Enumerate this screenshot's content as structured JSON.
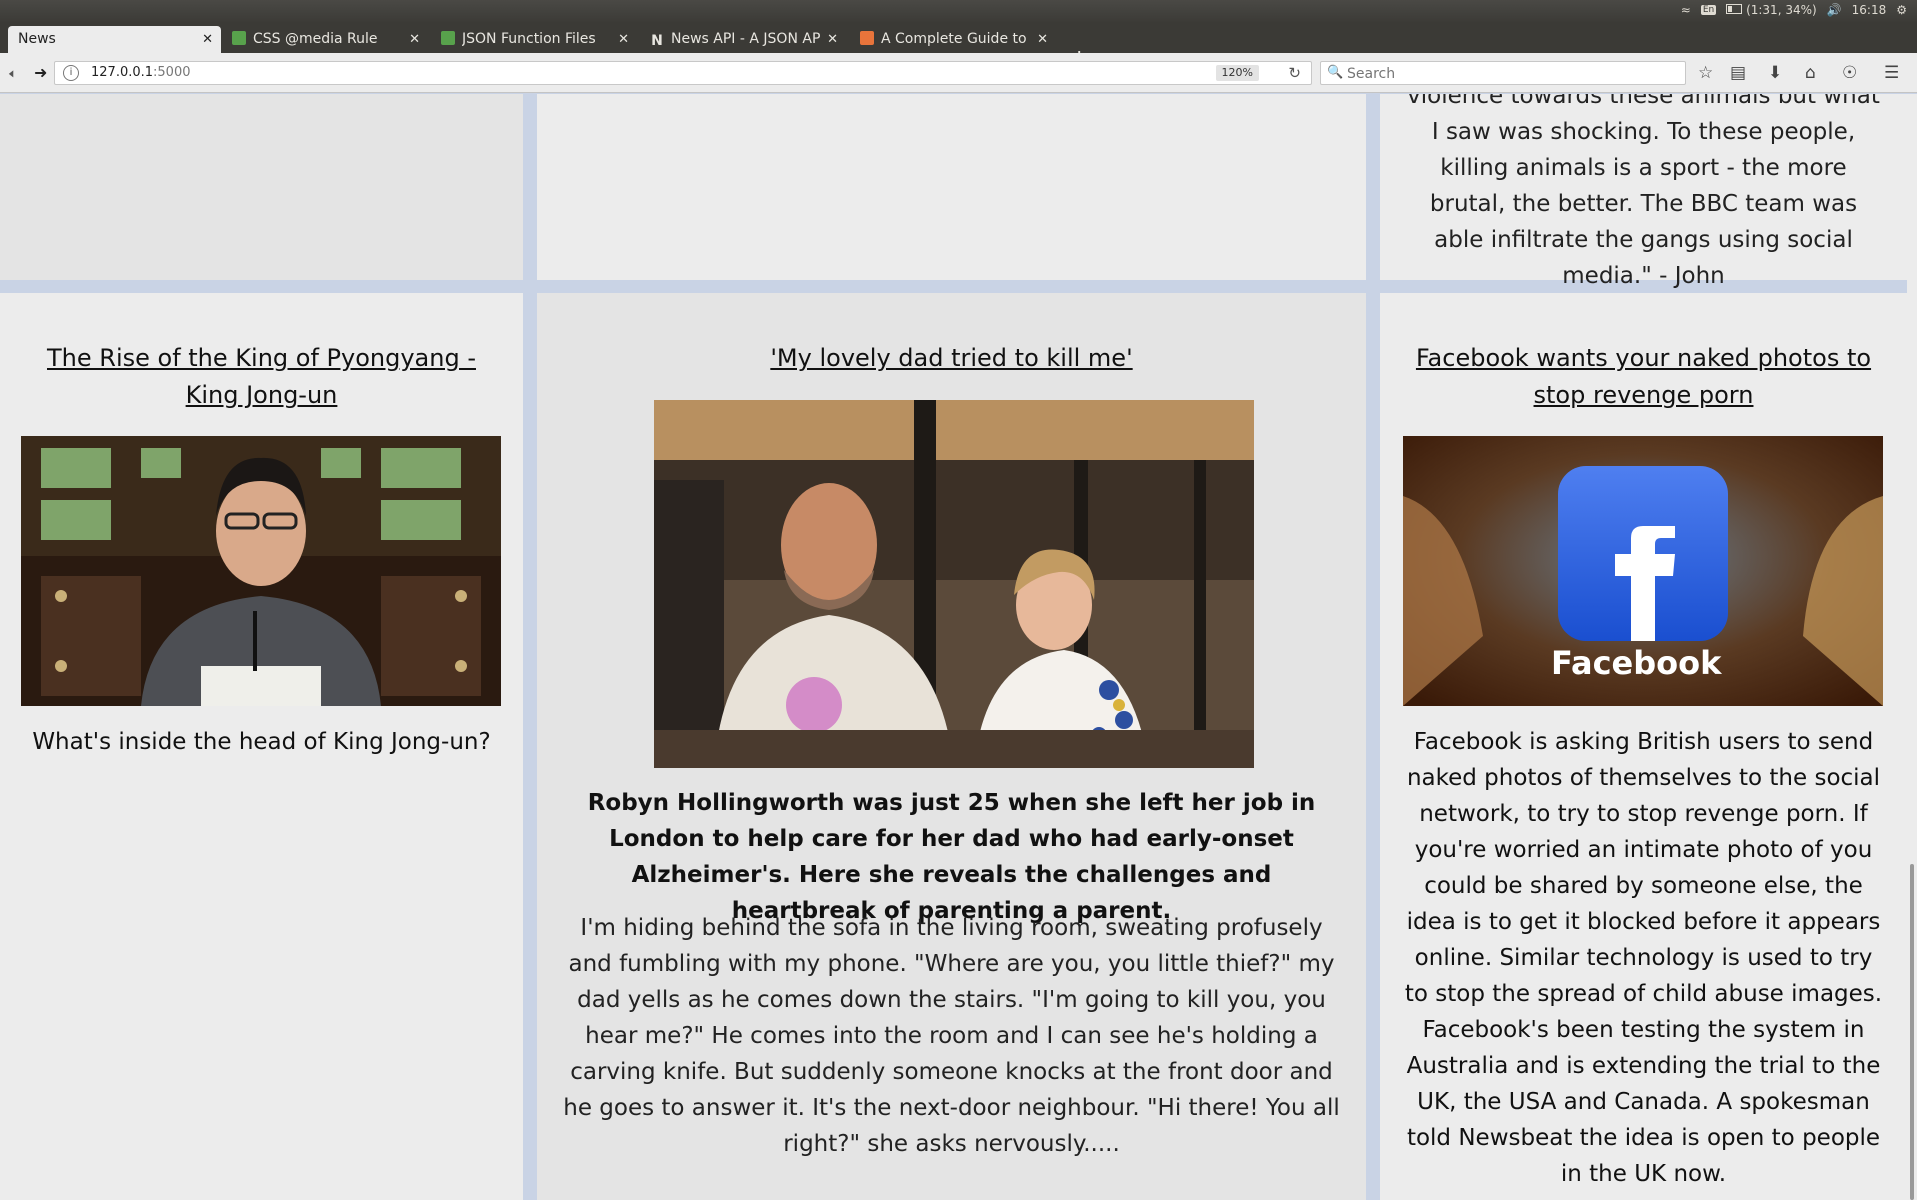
{
  "system": {
    "lang": "En",
    "battery": "(1:31, 34%)",
    "clock": "16:18"
  },
  "tabs": [
    {
      "title": "News",
      "favicon": "none",
      "active": true
    },
    {
      "title": "CSS @media Rule",
      "favicon": "w3schools-icon",
      "active": false
    },
    {
      "title": "JSON Function Files",
      "favicon": "w3schools-icon",
      "active": false
    },
    {
      "title": "News API - A JSON API",
      "favicon": "newsapi-icon",
      "active": false
    },
    {
      "title": "A Complete Guide to G",
      "favicon": "css-tricks-icon",
      "active": false
    }
  ],
  "new_tab": "+",
  "nav": {
    "url_host": "127.0.0.1",
    "url_port": ":5000",
    "zoom": "120%",
    "search_placeholder": "Search"
  },
  "page": {
    "top_snippet": "violence towards these animals but what I saw was shocking. To these people, killing animals is a sport - the more brutal, the better. The BBC team was able infiltrate the gangs using social media.\" - John",
    "articles": [
      {
        "title": "The Rise of the King of Pyongyang - King Jong-un",
        "image": "man-at-desk-photo",
        "summary": "What's inside the head of King Jong-un?"
      },
      {
        "title": "'My lovely dad tried to kill me'",
        "image": "father-and-daughter-photo",
        "summary": "Robyn Hollingworth was just 25 when she left her job in London to help care for her dad who had early-onset Alzheimer's. Here she reveals the challenges and heartbreak of parenting a parent.",
        "body": "I'm hiding behind the sofa in the living room, sweating profusely and fumbling with my phone. \"Where are you, you little thief?\" my dad yells as he comes down the stairs. \"I'm going to kill you, you hear me?\" He comes into the room and I can see he's holding a carving knife. But suddenly someone knocks at the front door and he goes to answer it. It's the next-door neighbour. \"Hi there! You all right?\" she asks nervously....."
      },
      {
        "title": "Facebook wants your naked photos to stop revenge porn",
        "image": "facebook-logo-photo",
        "image_text": "Facebook",
        "summary": "Facebook is asking British users to send naked photos of themselves to the social network, to try to stop revenge porn. If you're worried an intimate photo of you could be shared by someone else, the idea is to get it blocked before it appears online. Similar technology is used to try to stop the spread of child abuse images. Facebook's been testing the system in Australia and is extending the trial to the UK, the USA and Canada. A spokesman told Newsbeat the idea is open to people in the UK now."
      }
    ]
  },
  "colors": {
    "page_bg": "#c9d3e5",
    "card_a": "#e4e4e4",
    "card_b": "#ececec"
  }
}
